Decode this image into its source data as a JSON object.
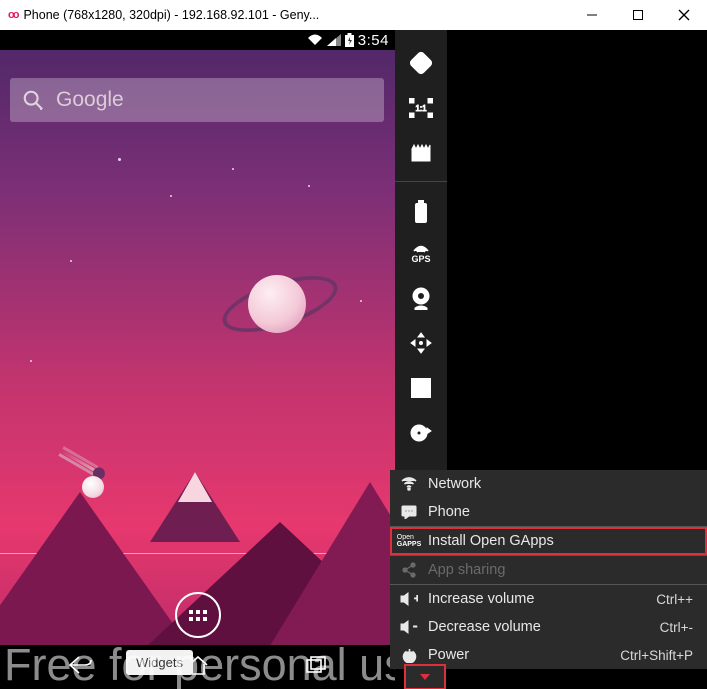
{
  "window": {
    "title": "Phone (768x1280, 320dpi) - 192.168.92.101 - Geny..."
  },
  "status": {
    "time": "3:54"
  },
  "search": {
    "placeholder": "Google"
  },
  "tooltip": {
    "text": "Widgets"
  },
  "watermark": "Free for personal use",
  "sidebar_icons": [
    "rotate-icon",
    "pixel-ratio-icon",
    "clapper-icon",
    "battery-icon",
    "gps-icon",
    "webcam-icon",
    "move-icon",
    "id-icon",
    "disk-icon"
  ],
  "gps_label": "GPS",
  "menu": {
    "items": [
      {
        "icon": "network-icon",
        "label": "Network"
      },
      {
        "icon": "phone-icon",
        "label": "Phone"
      },
      {
        "icon": "gapps-icon",
        "label": "Install Open GApps",
        "highlight": true,
        "divider_after": true
      },
      {
        "icon": "share-icon",
        "label": "App sharing",
        "disabled": true,
        "divider_after": true
      },
      {
        "icon": "vol-up-icon",
        "label": "Increase volume",
        "shortcut": "Ctrl++"
      },
      {
        "icon": "vol-down-icon",
        "label": "Decrease volume",
        "shortcut": "Ctrl+-"
      },
      {
        "icon": "power-icon",
        "label": "Power",
        "shortcut": "Ctrl+Shift+P"
      }
    ],
    "gapps_badge_l1": "Open",
    "gapps_badge_l2": "GAPPS"
  }
}
